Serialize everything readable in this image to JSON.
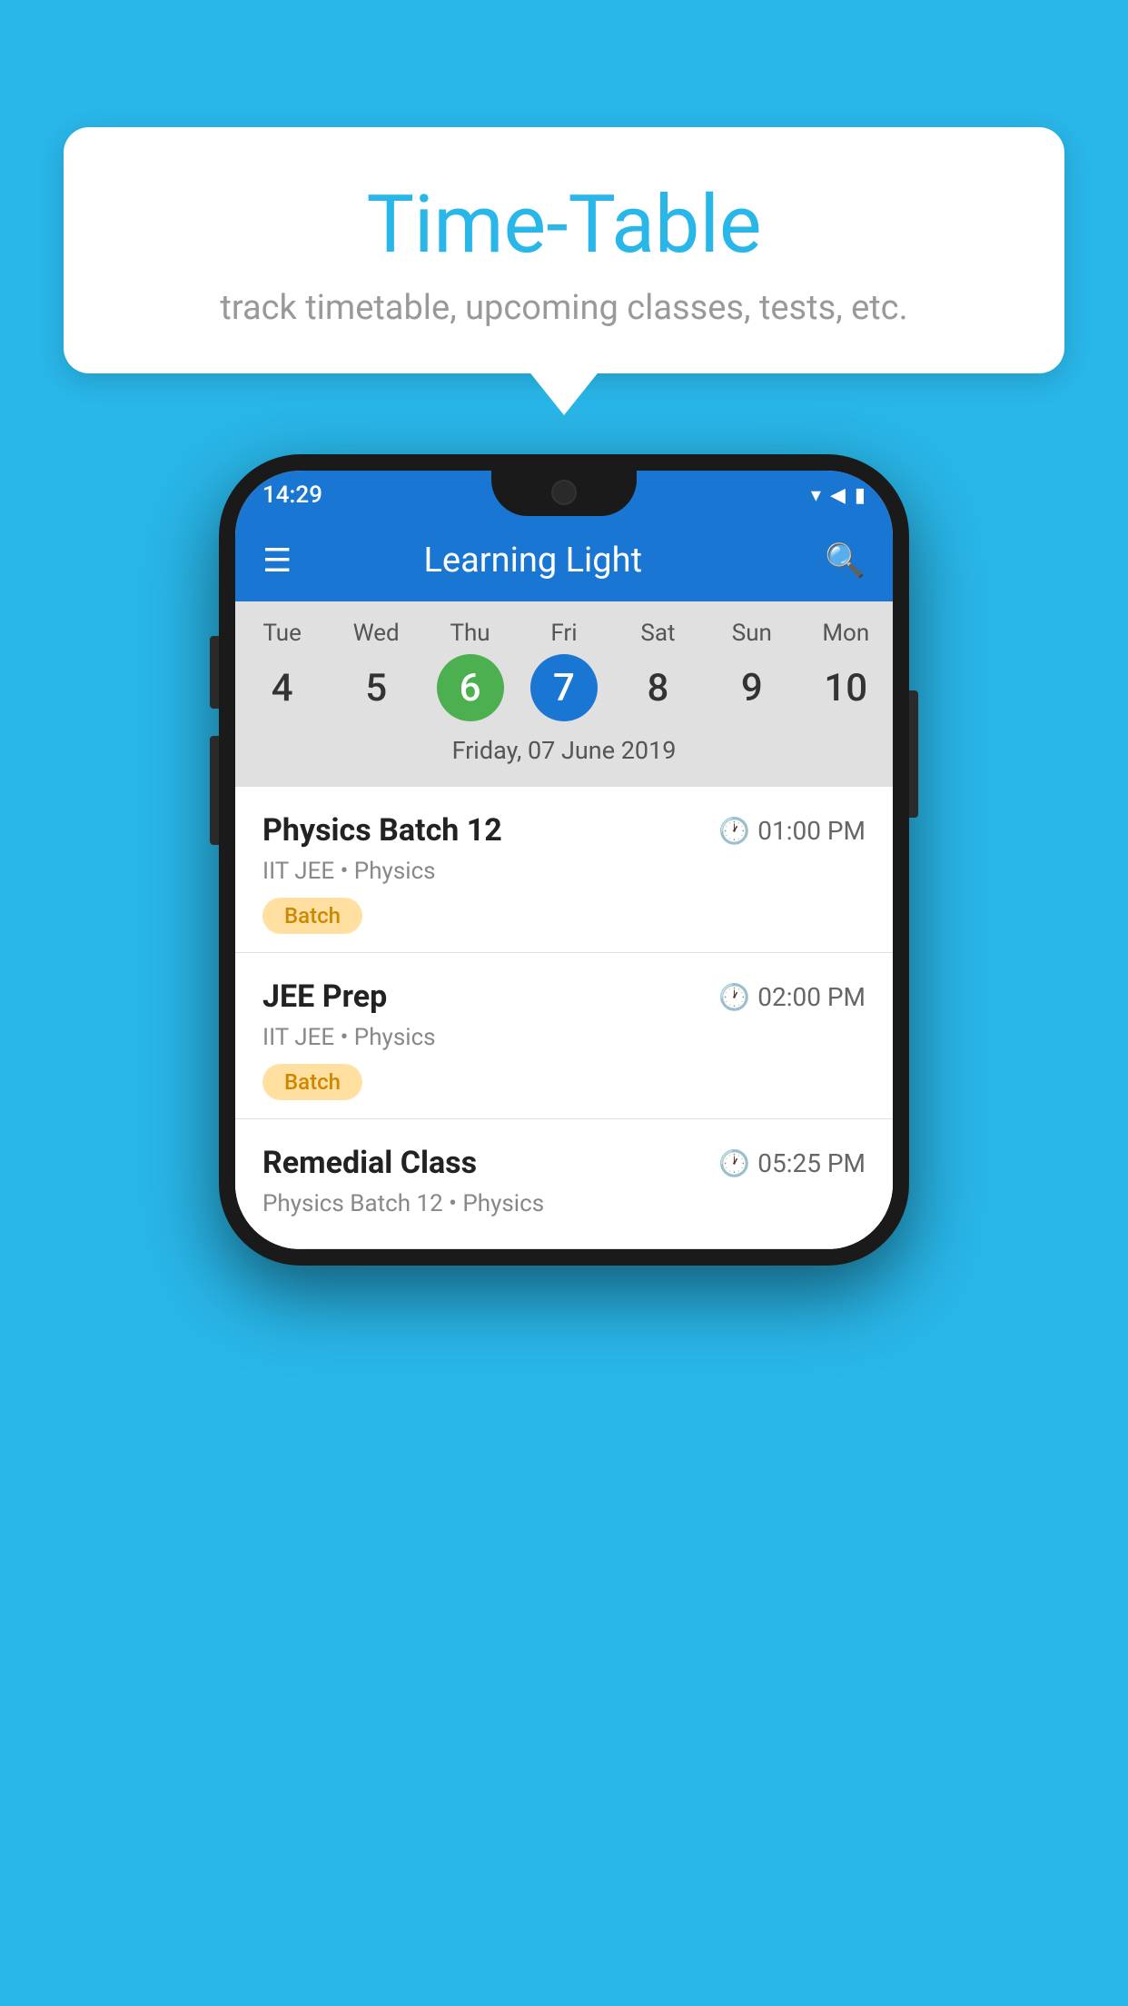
{
  "background_color": "#29B6E8",
  "bubble": {
    "title": "Time-Table",
    "subtitle": "track timetable, upcoming classes, tests, etc."
  },
  "status_bar": {
    "time": "14:29",
    "wifi_icon": "▾",
    "signal_icon": "▲",
    "battery_icon": "▮"
  },
  "app_bar": {
    "title": "Learning Light",
    "hamburger_label": "☰",
    "search_label": "🔍"
  },
  "calendar": {
    "days": [
      "Tue",
      "Wed",
      "Thu",
      "Fri",
      "Sat",
      "Sun",
      "Mon"
    ],
    "numbers": [
      "4",
      "5",
      "6",
      "7",
      "8",
      "9",
      "10"
    ],
    "today_index": 2,
    "selected_index": 3,
    "date_label": "Friday, 07 June 2019"
  },
  "schedule": [
    {
      "title": "Physics Batch 12",
      "time": "01:00 PM",
      "subtitle": "IIT JEE • Physics",
      "badge": "Batch"
    },
    {
      "title": "JEE Prep",
      "time": "02:00 PM",
      "subtitle": "IIT JEE • Physics",
      "badge": "Batch"
    },
    {
      "title": "Remedial Class",
      "time": "05:25 PM",
      "subtitle": "Physics Batch 12 • Physics",
      "badge": ""
    }
  ]
}
